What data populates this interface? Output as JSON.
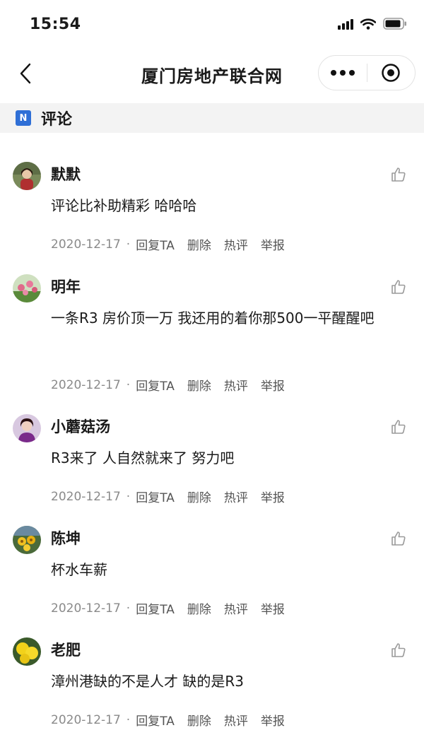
{
  "status_bar": {
    "time": "15:54"
  },
  "nav": {
    "title": "厦门房地产联合网"
  },
  "section": {
    "badge": "N",
    "title": "评论"
  },
  "comments": [
    {
      "name": "默默",
      "text": "评论比补助精彩 哈哈哈",
      "date": "2020-12-17",
      "dot": "·",
      "reply": "回复TA",
      "delete": "删除",
      "hot": "热评",
      "report": "举报"
    },
    {
      "name": "明年",
      "text": "一条R3 房价顶一万 我还用的着你那500一平醒醒吧",
      "date": "2020-12-17",
      "dot": "·",
      "reply": "回复TA",
      "delete": "删除",
      "hot": "热评",
      "report": "举报"
    },
    {
      "name": "小蘑菇汤",
      "text": "R3来了 人自然就来了 努力吧",
      "date": "2020-12-17",
      "dot": "·",
      "reply": "回复TA",
      "delete": "删除",
      "hot": "热评",
      "report": "举报"
    },
    {
      "name": "陈坤",
      "text": "杯水车薪",
      "date": "2020-12-17",
      "dot": "·",
      "reply": "回复TA",
      "delete": "删除",
      "hot": "热评",
      "report": "举报"
    },
    {
      "name": "老肥",
      "text": "漳州港缺的不是人才 缺的是R3",
      "date": "2020-12-17",
      "dot": "·",
      "reply": "回复TA",
      "delete": "删除",
      "hot": "热评",
      "report": "举报"
    }
  ],
  "colors": {
    "section_badge": "#2f6fd6",
    "meta_text": "#8a8a8a",
    "section_bg": "#f3f3f3"
  }
}
